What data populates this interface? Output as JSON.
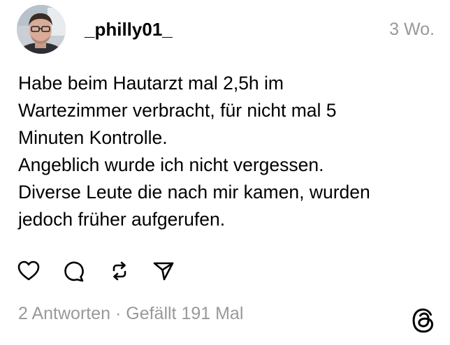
{
  "post": {
    "author": {
      "username": "_philly01_"
    },
    "timestamp": "3 Wo.",
    "body_lines": [
      "Habe beim Hautarzt mal 2,5h im",
      "Wartezimmer verbracht, für nicht mal 5",
      "Minuten Kontrolle.",
      "Angeblich wurde ich nicht vergessen.",
      "Diverse Leute die nach mir kamen, wurden",
      "jedoch früher aufgerufen."
    ],
    "actions": [
      {
        "id": "like",
        "icon": "heart-icon"
      },
      {
        "id": "reply",
        "icon": "speech-bubble-icon"
      },
      {
        "id": "repost",
        "icon": "repost-arrows-icon"
      },
      {
        "id": "share",
        "icon": "paper-plane-icon"
      }
    ],
    "stats": {
      "replies": "2 Antworten",
      "separator": " · ",
      "likes": "Gefällt 191 Mal"
    },
    "brand_icon": "threads-logo-icon"
  }
}
